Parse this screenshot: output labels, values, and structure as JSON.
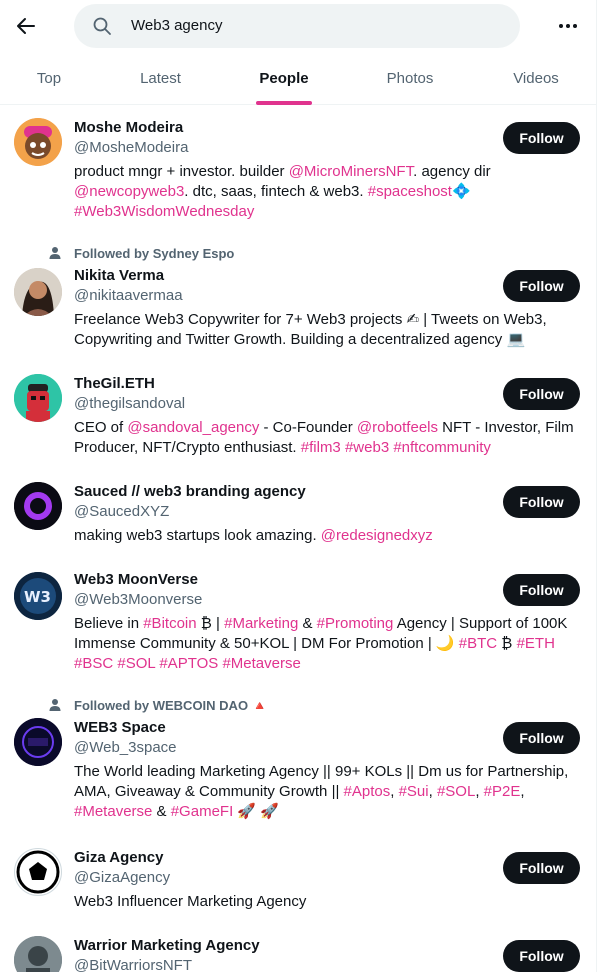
{
  "header": {
    "back_icon": "arrow-left-icon",
    "search_value": "Web3 agency",
    "more_icon": "more-horizontal-icon"
  },
  "tabs": [
    {
      "label": "Top"
    },
    {
      "label": "Latest"
    },
    {
      "label": "People"
    },
    {
      "label": "Photos"
    },
    {
      "label": "Videos"
    }
  ],
  "colors": {
    "accent": "#e0338e",
    "text": "#0f1419",
    "muted": "#536471"
  },
  "results": [
    {
      "name": "Moshe Modeira",
      "handle": "@MosheModeira",
      "follow_label": "Follow",
      "bio": [
        [
          {
            "t": "product mngr + investor. builder "
          },
          {
            "t": "@MicroMinersNFT",
            "h": 1
          },
          {
            "t": ". agency dir"
          }
        ],
        [
          {
            "t": "@newcopyweb3",
            "h": 1
          },
          {
            "t": ". dtc, saas, fintech & web3. "
          },
          {
            "t": "#spaceshost",
            "h": 1
          },
          {
            "t": "💠"
          }
        ],
        [
          {
            "t": "#Web3WisdomWednesday",
            "h": 1
          }
        ]
      ]
    },
    {
      "social_context": "Followed by Sydney Espo",
      "name": "Nikita Verma",
      "handle": "@nikitaavermaa",
      "follow_label": "Follow",
      "bio": [
        [
          {
            "t": "Freelance Web3 Copywriter for 7+ Web3 projects ✍ | Tweets on Web3,"
          }
        ],
        [
          {
            "t": "Copywriting and Twitter Growth. Building a decentralized agency 💻"
          }
        ]
      ]
    },
    {
      "name": "TheGil.ETH",
      "handle": "@thegilsandoval",
      "follow_label": "Follow",
      "bio": [
        [
          {
            "t": "CEO of "
          },
          {
            "t": "@sandoval_agency",
            "h": 1
          },
          {
            "t": " - Co-Founder "
          },
          {
            "t": "@robotfeels",
            "h": 1
          },
          {
            "t": " NFT - Investor, Film"
          }
        ],
        [
          {
            "t": "Producer, NFT/Crypto enthusiast. "
          },
          {
            "t": "#film3",
            "h": 1
          },
          {
            "t": " "
          },
          {
            "t": "#web3",
            "h": 1
          },
          {
            "t": " "
          },
          {
            "t": "#nftcommunity",
            "h": 1
          }
        ]
      ]
    },
    {
      "name": "Sauced // web3 branding agency",
      "handle": "@SaucedXYZ",
      "follow_label": "Follow",
      "bio": [
        [
          {
            "t": "making web3 startups look amazing. "
          },
          {
            "t": "@redesignedxyz",
            "h": 1
          }
        ]
      ]
    },
    {
      "name": "Web3 MoonVerse",
      "handle": "@Web3Moonverse",
      "follow_label": "Follow",
      "bio": [
        [
          {
            "t": "Believe in "
          },
          {
            "t": "#Bitcoin",
            "h": 1
          },
          {
            "t": " ₿ | "
          },
          {
            "t": "#Marketing",
            "h": 1
          },
          {
            "t": " & "
          },
          {
            "t": "#Promoting",
            "h": 1
          },
          {
            "t": " Agency | Support of 100K"
          }
        ],
        [
          {
            "t": "Immense Community & 50+KOL | DM For Promotion | 🌙 "
          },
          {
            "t": "#BTC",
            "h": 1
          },
          {
            "t": " ₿ "
          },
          {
            "t": "#ETH",
            "h": 1
          }
        ],
        [
          {
            "t": "#BSC",
            "h": 1
          },
          {
            "t": " "
          },
          {
            "t": "#SOL",
            "h": 1
          },
          {
            "t": " "
          },
          {
            "t": "#APTOS",
            "h": 1
          },
          {
            "t": " "
          },
          {
            "t": "#Metaverse",
            "h": 1
          }
        ]
      ]
    },
    {
      "social_context": "Followed by WEBCOIN DAO 🔺",
      "name": "WEB3 Space",
      "handle": "@Web_3space",
      "follow_label": "Follow",
      "bio": [
        [
          {
            "t": "The World leading Marketing Agency || 99+ KOLs || Dm us for Partnership,"
          }
        ],
        [
          {
            "t": "AMA, Giveaway & Community Growth || "
          },
          {
            "t": "#Aptos",
            "h": 1
          },
          {
            "t": ", "
          },
          {
            "t": "#Sui",
            "h": 1
          },
          {
            "t": ", "
          },
          {
            "t": "#SOL",
            "h": 1
          },
          {
            "t": ", "
          },
          {
            "t": "#P2E",
            "h": 1
          },
          {
            "t": ","
          }
        ],
        [
          {
            "t": "#Metaverse",
            "h": 1
          },
          {
            "t": " & "
          },
          {
            "t": "#GameFI",
            "h": 1
          },
          {
            "t": " 🚀 🚀"
          }
        ]
      ]
    },
    {
      "name": "Giza Agency",
      "handle": "@GizaAgency",
      "follow_label": "Follow",
      "bio": [
        [
          {
            "t": "Web3 Influencer Marketing Agency"
          }
        ]
      ]
    },
    {
      "name": "Warrior Marketing Agency",
      "handle": "@BitWarriorsNFT",
      "follow_label": "Follow",
      "bio": []
    }
  ]
}
